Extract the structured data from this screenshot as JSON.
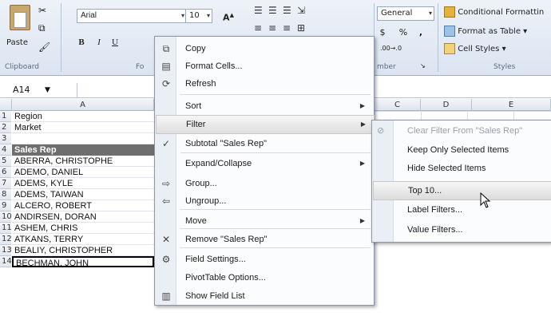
{
  "ribbon": {
    "clipboard": {
      "paste": "Paste",
      "group": "Clipboard"
    },
    "font": {
      "name": "Arial",
      "size": "10",
      "bold": "B",
      "italic": "I",
      "underline": "U",
      "grow": "A",
      "group": "Fo"
    },
    "number": {
      "format": "General",
      "currency": "$",
      "percent": "%",
      "comma": ",",
      "group": "mber"
    },
    "styles": {
      "conditional": "Conditional Formattin",
      "format_table": "Format as Table",
      "cell_styles": "Cell Styles",
      "group": "Styles"
    }
  },
  "formula_bar": {
    "name_box": "A14"
  },
  "grid": {
    "columns": [
      "A",
      "C",
      "D",
      "E"
    ],
    "rows": [
      {
        "num": "1",
        "a": "Region",
        "header": false
      },
      {
        "num": "2",
        "a": "Market",
        "header": false
      },
      {
        "num": "3",
        "a": "",
        "header": false
      },
      {
        "num": "4",
        "a": "Sales Rep",
        "header": true
      },
      {
        "num": "5",
        "a": "ABERRA, CHRISTOPHE",
        "header": false
      },
      {
        "num": "6",
        "a": "ADEMO, DANIEL",
        "header": false
      },
      {
        "num": "7",
        "a": "ADEMS, KYLE",
        "header": false
      },
      {
        "num": "8",
        "a": "ADEMS, TAIWAN",
        "header": false
      },
      {
        "num": "9",
        "a": "ALCERO, ROBERT",
        "header": false
      },
      {
        "num": "10",
        "a": "ANDIRSEN, DORAN",
        "header": false
      },
      {
        "num": "11",
        "a": "ASHEM, CHRIS",
        "header": false
      },
      {
        "num": "12",
        "a": "ATKANS, TERRY",
        "header": false
      },
      {
        "num": "13",
        "a": "BEALIY, CHRISTOPHER",
        "header": false
      },
      {
        "num": "14",
        "a": "BECHMAN, JOHN",
        "header": false
      }
    ]
  },
  "context_menu": {
    "items": [
      {
        "label": "Copy",
        "icon": "copy-icon",
        "submenu": false
      },
      {
        "label": "Format Cells...",
        "icon": "format-cells-icon",
        "submenu": false
      },
      {
        "label": "Refresh",
        "icon": "refresh-icon",
        "submenu": false
      },
      {
        "label": "Sort",
        "icon": "",
        "submenu": true
      },
      {
        "label": "Filter",
        "icon": "",
        "submenu": true,
        "highlighted": true
      },
      {
        "label": "Subtotal \"Sales Rep\"",
        "icon": "checkmark-icon",
        "submenu": false
      },
      {
        "label": "Expand/Collapse",
        "icon": "",
        "submenu": true
      },
      {
        "label": "Group...",
        "icon": "group-icon",
        "submenu": false
      },
      {
        "label": "Ungroup...",
        "icon": "ungroup-icon",
        "submenu": false
      },
      {
        "label": "Move",
        "icon": "",
        "submenu": true
      },
      {
        "label": "Remove \"Sales Rep\"",
        "icon": "remove-icon",
        "submenu": false
      },
      {
        "label": "Field Settings...",
        "icon": "field-settings-icon",
        "submenu": false
      },
      {
        "label": "PivotTable Options...",
        "icon": "",
        "submenu": false
      },
      {
        "label": "Show Field List",
        "icon": "field-list-icon",
        "submenu": false
      }
    ]
  },
  "filter_submenu": {
    "items": [
      {
        "label": "Clear Filter From \"Sales Rep\"",
        "disabled": true
      },
      {
        "label": "Keep Only Selected Items",
        "disabled": false
      },
      {
        "label": "Hide Selected Items",
        "disabled": false
      },
      {
        "label": "Top 10...",
        "disabled": false,
        "highlighted": true
      },
      {
        "label": "Label Filters...",
        "disabled": false
      },
      {
        "label": "Value Filters...",
        "disabled": false
      }
    ]
  },
  "colors": {
    "header_fill": "#6e6e6e",
    "ribbon_bg": "#dbe4f1",
    "menu_highlight": "#dedede"
  }
}
